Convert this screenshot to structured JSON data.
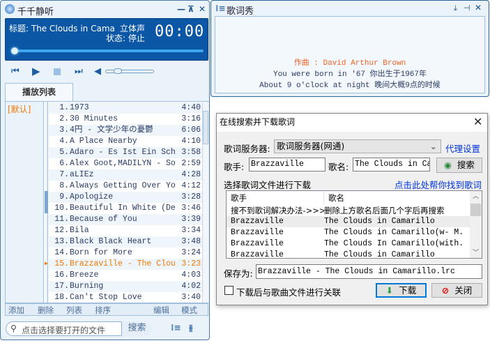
{
  "player": {
    "title": "千千静听",
    "window_buttons": [
      "—",
      "⊼",
      "✕"
    ],
    "display": {
      "title_label": "标题: The Clouds in Cama",
      "channel": "立体声",
      "status": "状态: 停止",
      "time": "00:00",
      "progress": 0,
      "volume": 0.2
    },
    "tab": "播放列表",
    "category": "[默认]",
    "playlist": [
      {
        "num": "1.",
        "name": "1973",
        "dur": "4:40"
      },
      {
        "num": "2.",
        "name": "30 Minutes",
        "dur": "3:16"
      },
      {
        "num": "3.",
        "name": "4円 - 文学少年の憂鬱",
        "dur": "6:06"
      },
      {
        "num": "4.",
        "name": "A Place Nearby",
        "dur": "4:10"
      },
      {
        "num": "5.",
        "name": "Adaro - Es Ist Ein Schne...",
        "dur": "3:58"
      },
      {
        "num": "6.",
        "name": "Alex Goot,MADILYN - Some...",
        "dur": "2:59"
      },
      {
        "num": "7.",
        "name": "aLIEz",
        "dur": "4:28"
      },
      {
        "num": "8.",
        "name": "Always Getting Over You",
        "dur": "4:12"
      },
      {
        "num": "9.",
        "name": "Apologize",
        "dur": "3:28"
      },
      {
        "num": "10.",
        "name": "Beautiful In White (Demo)",
        "dur": "3:46"
      },
      {
        "num": "11.",
        "name": "Because of You",
        "dur": "3:39"
      },
      {
        "num": "12.",
        "name": "Bila",
        "dur": "3:34"
      },
      {
        "num": "13.",
        "name": "Black Black Heart",
        "dur": "3:48"
      },
      {
        "num": "14.",
        "name": "Born for More",
        "dur": "3:24"
      },
      {
        "num": "15.",
        "name": "Brazzaville - The Clouds...",
        "dur": "3:23"
      },
      {
        "num": "16.",
        "name": "Breeze",
        "dur": "4:03"
      },
      {
        "num": "17.",
        "name": "Burning",
        "dur": "4:02"
      },
      {
        "num": "18.",
        "name": "Can't Stop Love",
        "dur": "3:40"
      }
    ],
    "current_index": 14,
    "toolbar": {
      "add": "添加",
      "delete": "删除",
      "list": "列表",
      "sort": "排序",
      "edit": "编辑",
      "mode": "模式"
    },
    "search": {
      "placeholder": "点击选择要打开的文件",
      "button": "搜索"
    }
  },
  "lyrics": {
    "title": "歌词秀",
    "lines": [
      "作曲 : David Arthur Brown",
      "You were born in '67 你出生于1967年",
      "About 9 o'clock at night 晚间大概9点的时候"
    ]
  },
  "dialog": {
    "title": "在线搜索并下载歌词",
    "server_label": "歌词服务器:",
    "server_value": "歌词服务器(网通)",
    "proxy_link": "代理设置",
    "artist_label": "歌手:",
    "artist_value": "Brazzaville",
    "song_label": "歌名:",
    "song_value": "The Clouds in Camarillo",
    "search_button": "搜索",
    "select_label": "选择歌词文件进行下载",
    "help_link": "点击此处帮你找到歌词",
    "columns": [
      "歌手",
      "歌名"
    ],
    "results": [
      {
        "artist": "搜不到歌词解决办法->>>",
        "song": "删除上方歌名后面几个字后再搜索"
      },
      {
        "artist": "Brazzaville",
        "song": "The Clouds in Camarillo"
      },
      {
        "artist": "Brazzaville",
        "song": "The Clouds in Camarillo(w- M..."
      },
      {
        "artist": "Brazzaville",
        "song": "The Clouds In Camarillo(with..."
      },
      {
        "artist": "Brazzaville",
        "song": "The Clouds in Camarillo"
      }
    ],
    "save_label": "保存为:",
    "save_value": "Brazzaville - The Clouds in Camarillo.lrc",
    "associate_label": "下载后与歌曲文件进行关联",
    "download_button": "下载",
    "close_button": "关闭"
  }
}
